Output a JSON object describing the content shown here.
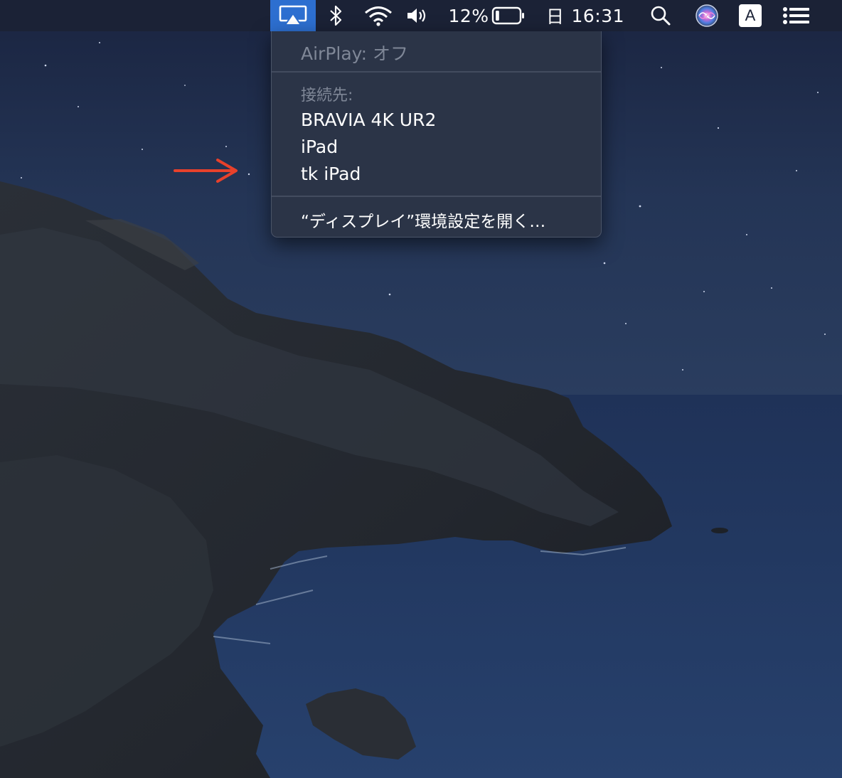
{
  "menubar": {
    "battery_percent": "12%",
    "battery_level": 0.12,
    "day": "日",
    "time": "16:31",
    "input_source": "A",
    "icons": [
      "airplay-icon",
      "bluetooth-icon",
      "wifi-icon",
      "volume-icon",
      "battery-icon",
      "search-icon",
      "siri-icon",
      "input-source-icon",
      "notification-center-icon"
    ]
  },
  "airplay_menu": {
    "status": "AirPlay: オフ",
    "connect_header": "接続先:",
    "devices": [
      "BRAVIA 4K UR2",
      "iPad",
      "tk iPad"
    ],
    "display_prefs": "“ディスプレイ”環境設定を開く…"
  },
  "colors": {
    "menubar_bg": "#1b2236",
    "airplay_highlight": "#2d6fd0",
    "menu_bg": "#2b3447",
    "arrow": "#e8412b",
    "sea": "#243b63"
  }
}
